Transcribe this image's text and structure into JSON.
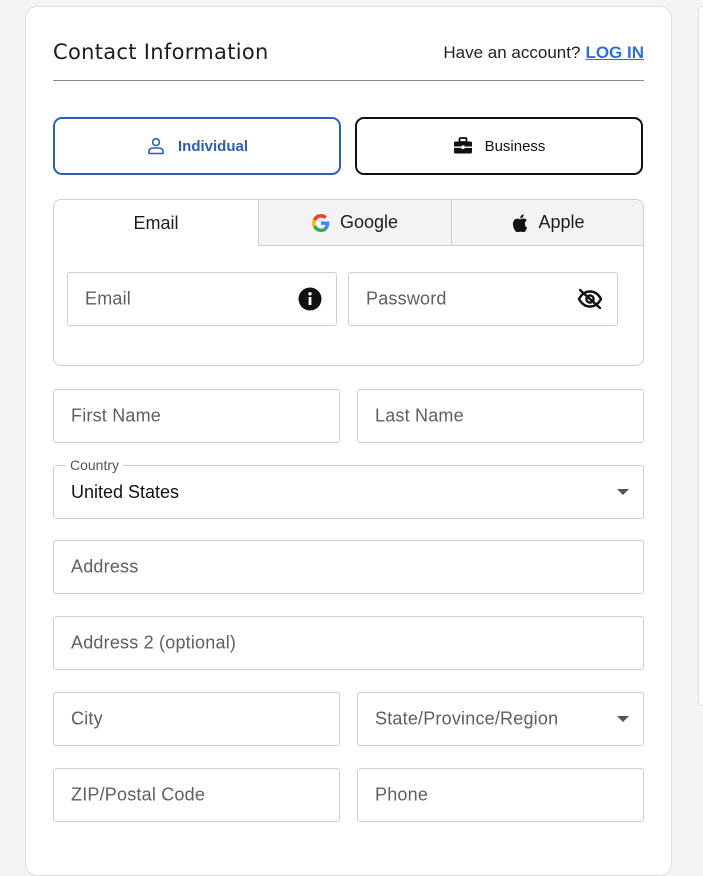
{
  "header": {
    "title": "Contact Information",
    "account_prompt": "Have an account?",
    "login_link": "LOG IN"
  },
  "account_types": {
    "individual": {
      "label": "Individual",
      "icon": "person-icon",
      "selected": true
    },
    "business": {
      "label": "Business",
      "icon": "briefcase-icon",
      "selected": false
    }
  },
  "auth_tabs": {
    "email": {
      "label": "Email",
      "active": true
    },
    "google": {
      "label": "Google",
      "icon": "google-icon"
    },
    "apple": {
      "label": "Apple",
      "icon": "apple-icon"
    }
  },
  "login_fields": {
    "email": {
      "placeholder": "Email",
      "icon": "info-icon"
    },
    "password": {
      "placeholder": "Password",
      "icon": "eye-off-icon"
    }
  },
  "form": {
    "first_name": "First Name",
    "last_name": "Last Name",
    "country": {
      "label": "Country",
      "value": "United States"
    },
    "address": "Address",
    "address2": "Address 2 (optional)",
    "city": "City",
    "state": "State/Province/Region",
    "zip": "ZIP/Postal Code",
    "phone": "Phone"
  },
  "colors": {
    "accent": "#2f5fb0",
    "link": "#2f6fdf",
    "border": "#cfcfcf",
    "background": "#f4f4f4"
  }
}
